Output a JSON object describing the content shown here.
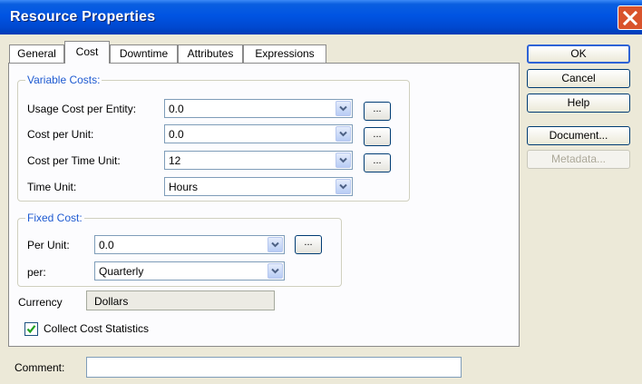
{
  "window": {
    "title": "Resource Properties"
  },
  "tabs": [
    {
      "label": "General",
      "active": false
    },
    {
      "label": "Cost",
      "active": true
    },
    {
      "label": "Downtime",
      "active": false
    },
    {
      "label": "Attributes",
      "active": false
    },
    {
      "label": "Expressions",
      "active": false
    }
  ],
  "variable_costs": {
    "title": "Variable Costs:",
    "usage_cost_label": "Usage Cost per Entity:",
    "usage_cost_value": "0.0",
    "cost_per_unit_label": "Cost per Unit:",
    "cost_per_unit_value": "0.0",
    "cost_per_time_label": "Cost per Time Unit:",
    "cost_per_time_value": "12",
    "time_unit_label": "Time Unit:",
    "time_unit_value": "Hours",
    "ellipsis_label": "..."
  },
  "fixed_cost": {
    "title": "Fixed Cost:",
    "per_unit_label": "Per Unit:",
    "per_unit_value": "0.0",
    "per_label": "per:",
    "per_value": "Quarterly",
    "ellipsis_label": "..."
  },
  "currency": {
    "label": "Currency",
    "value": "Dollars"
  },
  "collect_stats": {
    "label": "Collect Cost Statistics",
    "checked": true
  },
  "comment": {
    "label": "Comment:",
    "value": ""
  },
  "buttons": {
    "ok": "OK",
    "cancel": "Cancel",
    "help": "Help",
    "document": "Document...",
    "metadata": "Metadata..."
  },
  "colors": {
    "title_bar": "#0054e3",
    "group_title": "#1f5bd1",
    "close_button": "#d9532c"
  }
}
